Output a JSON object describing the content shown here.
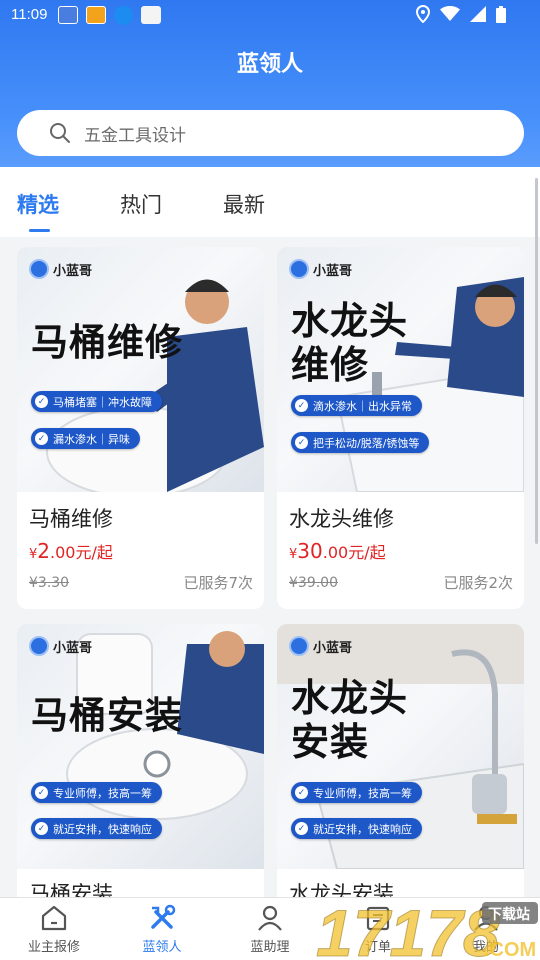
{
  "status_bar": {
    "time": "11:09"
  },
  "header": {
    "title": "蓝领人"
  },
  "search": {
    "placeholder": "五金工具设计"
  },
  "tabs": [
    {
      "label": "精选",
      "active": true
    },
    {
      "label": "热门",
      "active": false
    },
    {
      "label": "最新",
      "active": false
    }
  ],
  "brand_label": "小蓝哥",
  "products": [
    {
      "name": "马桶维修",
      "price_symbol": "¥",
      "price_int": "2",
      "price_dec": ".00",
      "price_unit": "元/起",
      "original_price": "¥3.30",
      "served": "已服务7次",
      "poster_lines": [
        "马桶维修"
      ],
      "tags": [
        "马桶堵塞｜冲水故障",
        "漏水渗水｜异味"
      ]
    },
    {
      "name": "水龙头维修",
      "price_symbol": "¥",
      "price_int": "30",
      "price_dec": ".00",
      "price_unit": "元/起",
      "original_price": "¥39.00",
      "served": "已服务2次",
      "poster_lines": [
        "水龙头",
        "维修"
      ],
      "tags": [
        "滴水渗水｜出水异常",
        "把手松动/脱落/锈蚀等"
      ]
    },
    {
      "name": "马桶安装",
      "poster_lines": [
        "马桶安装"
      ],
      "tags": [
        "专业师傅，技高一筹",
        "就近安排，快速响应"
      ]
    },
    {
      "name": "水龙头安装",
      "poster_lines": [
        "水龙头",
        "安装"
      ],
      "tags": [
        "专业师傅，技高一筹",
        "就近安排，快速响应"
      ]
    }
  ],
  "bottom_nav": [
    {
      "label": "业主报修",
      "icon": "home-icon",
      "active": false
    },
    {
      "label": "蓝领人",
      "icon": "tools-icon",
      "active": true
    },
    {
      "label": "蓝助理",
      "icon": "person-icon",
      "active": false
    },
    {
      "label": "订单",
      "icon": "order-icon",
      "active": false
    },
    {
      "label": "我的",
      "icon": "profile-icon",
      "active": false
    }
  ],
  "watermark": {
    "number": "17178",
    "suffix": ".COM",
    "badge": "下载站"
  },
  "colors": {
    "primary": "#2d7bef",
    "price": "#e02424",
    "header": "#3d86f6"
  }
}
